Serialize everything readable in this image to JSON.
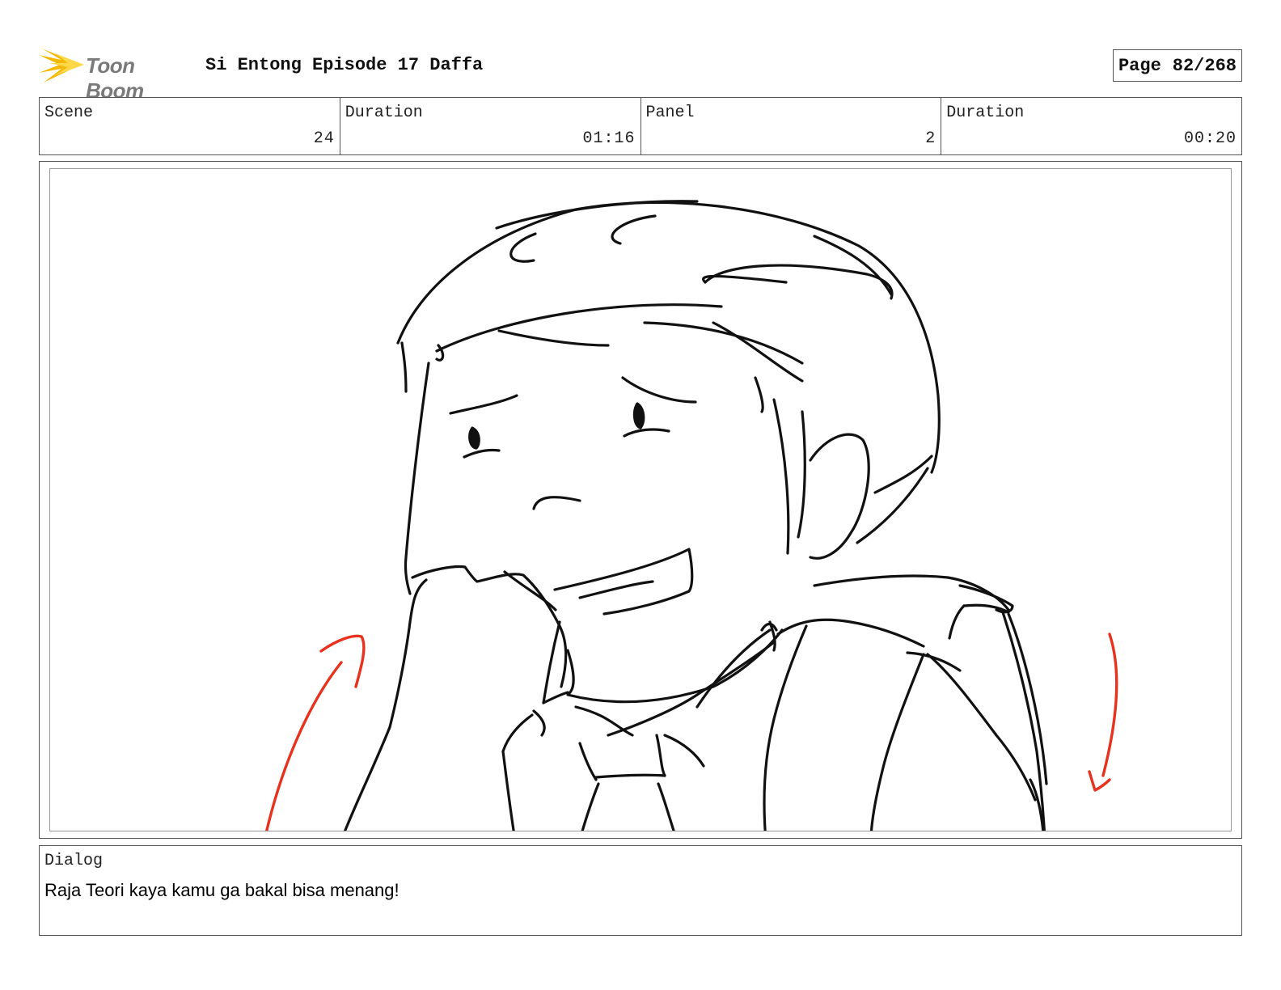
{
  "header": {
    "logo_text": "Toon Boom",
    "title": "Si Entong Episode 17 Daffa",
    "page_label": "Page",
    "page_value": "82/268"
  },
  "info": {
    "scene_label": "Scene",
    "scene_value": "24",
    "scene_duration_label": "Duration",
    "scene_duration_value": "01:16",
    "panel_label": "Panel",
    "panel_value": "2",
    "panel_duration_label": "Duration",
    "panel_duration_value": "00:20"
  },
  "dialog": {
    "label": "Dialog",
    "text": "Raja Teori kaya kamu ga bakal bisa menang!"
  },
  "colors": {
    "sketch_line": "#111111",
    "arrow": "#e8321e",
    "logo_star": "#f5b800",
    "border": "#555555"
  }
}
